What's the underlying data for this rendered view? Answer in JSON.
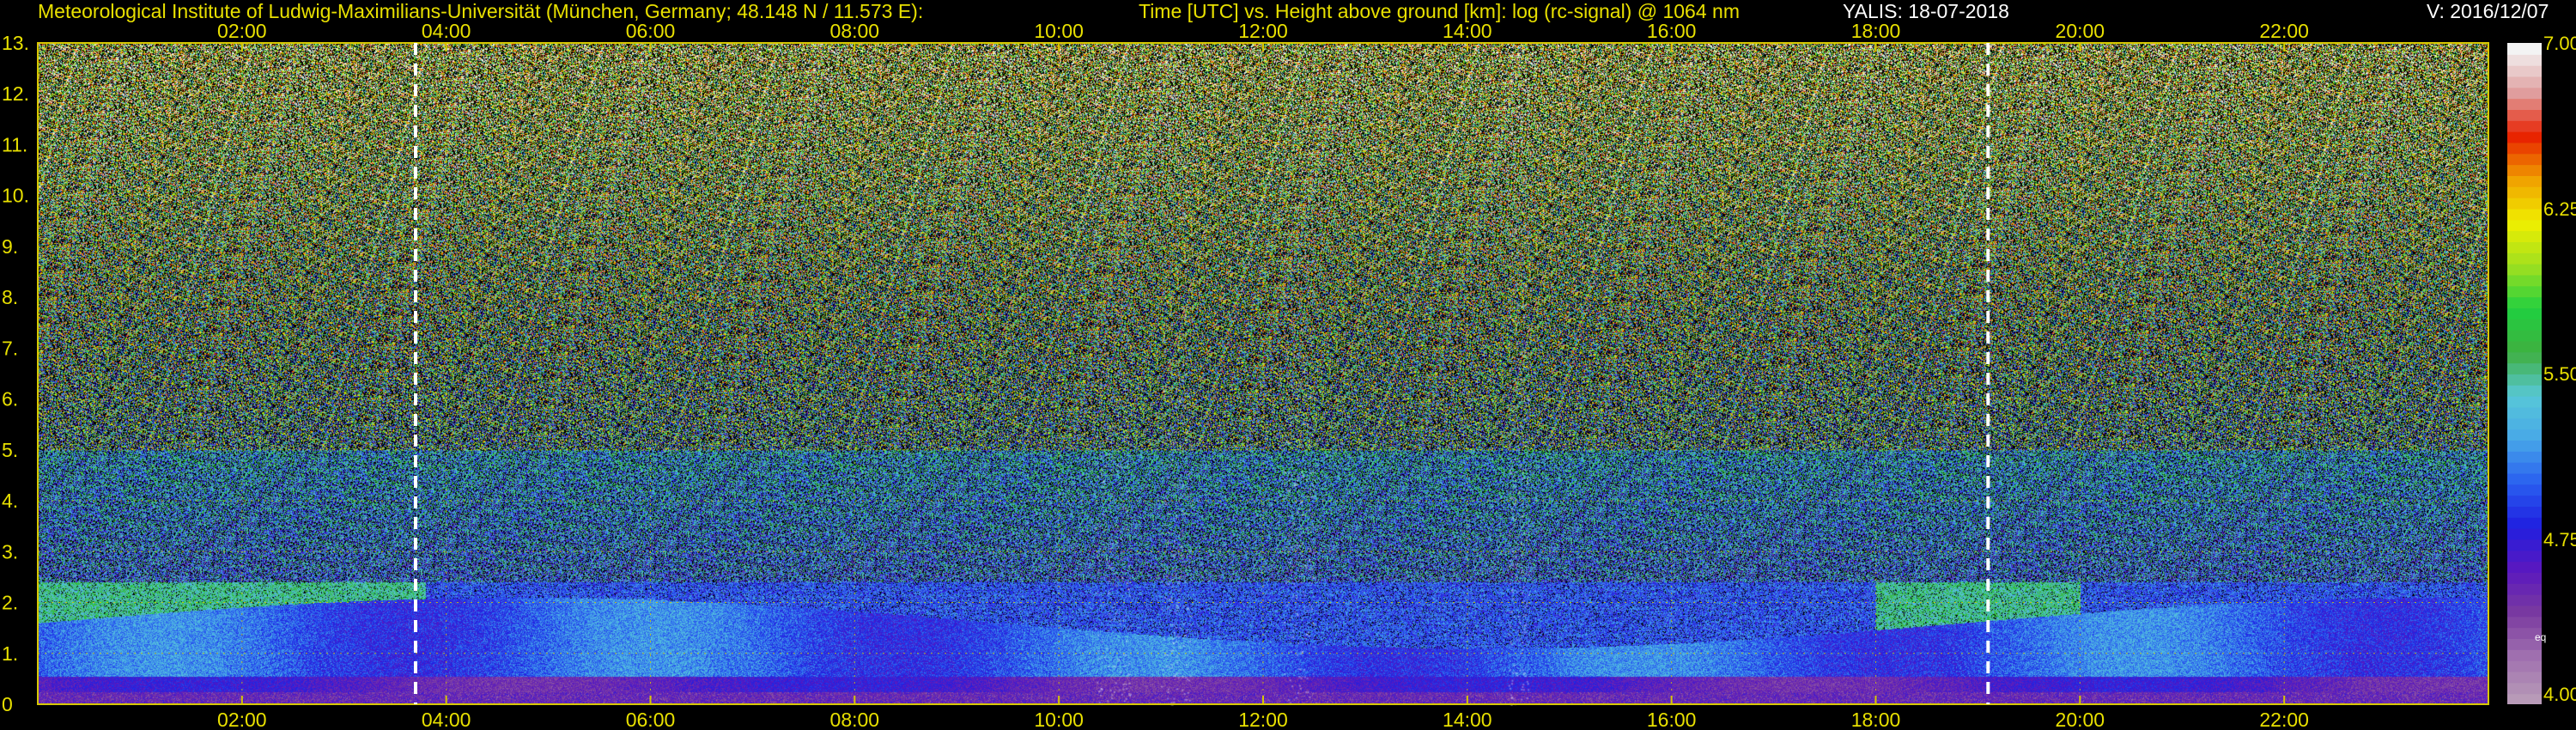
{
  "header": {
    "institute": "Meteorological Institute of Ludwig-Maximilians-Universität (München, Germany; 48.148 N / 11.573 E):",
    "description": "Time [UTC] vs. Height above ground [km]: log (rc-signal) @ 1064 nm",
    "instrument": "YALIS: 18-07-2018",
    "version": "V: 2016/12/07"
  },
  "chart_data": {
    "type": "heatmap",
    "xlabel": "Time [UTC]",
    "ylabel": "Height above ground [km]",
    "x_ticks": [
      "02:00",
      "04:00",
      "06:00",
      "08:00",
      "10:00",
      "12:00",
      "14:00",
      "16:00",
      "18:00",
      "20:00",
      "22:00"
    ],
    "x_tick_hours": [
      2,
      4,
      6,
      8,
      10,
      12,
      14,
      16,
      18,
      20,
      22
    ],
    "xlim_hours": [
      0,
      24
    ],
    "y_ticks": [
      "0",
      "1.",
      "2.",
      "3.",
      "4.",
      "5.",
      "6.",
      "7.",
      "8.",
      "9.",
      "10.",
      "11.",
      "12.",
      "13."
    ],
    "ylim_km": [
      0,
      13
    ],
    "grid": true,
    "grid_color": "#d8c800",
    "dashed_markers_hours": [
      3.7,
      19.1
    ],
    "colorbar": {
      "range": [
        4.0,
        7.0
      ],
      "tick_labels": [
        "7.00",
        "6.25",
        "5.50",
        "4.75",
        "4.00"
      ],
      "tick_values": [
        7.0,
        6.25,
        5.5,
        4.75,
        4.0
      ],
      "note": "eq"
    },
    "colormap": [
      "#b89ab8",
      "#a070b0",
      "#7a3aa0",
      "#5a18c0",
      "#2020e0",
      "#2a60f0",
      "#48a8e8",
      "#58c8d8",
      "#40b040",
      "#20d040",
      "#a0e020",
      "#f0f000",
      "#f0a000",
      "#e82000",
      "#e0a0a0",
      "#f4f4f4"
    ]
  }
}
